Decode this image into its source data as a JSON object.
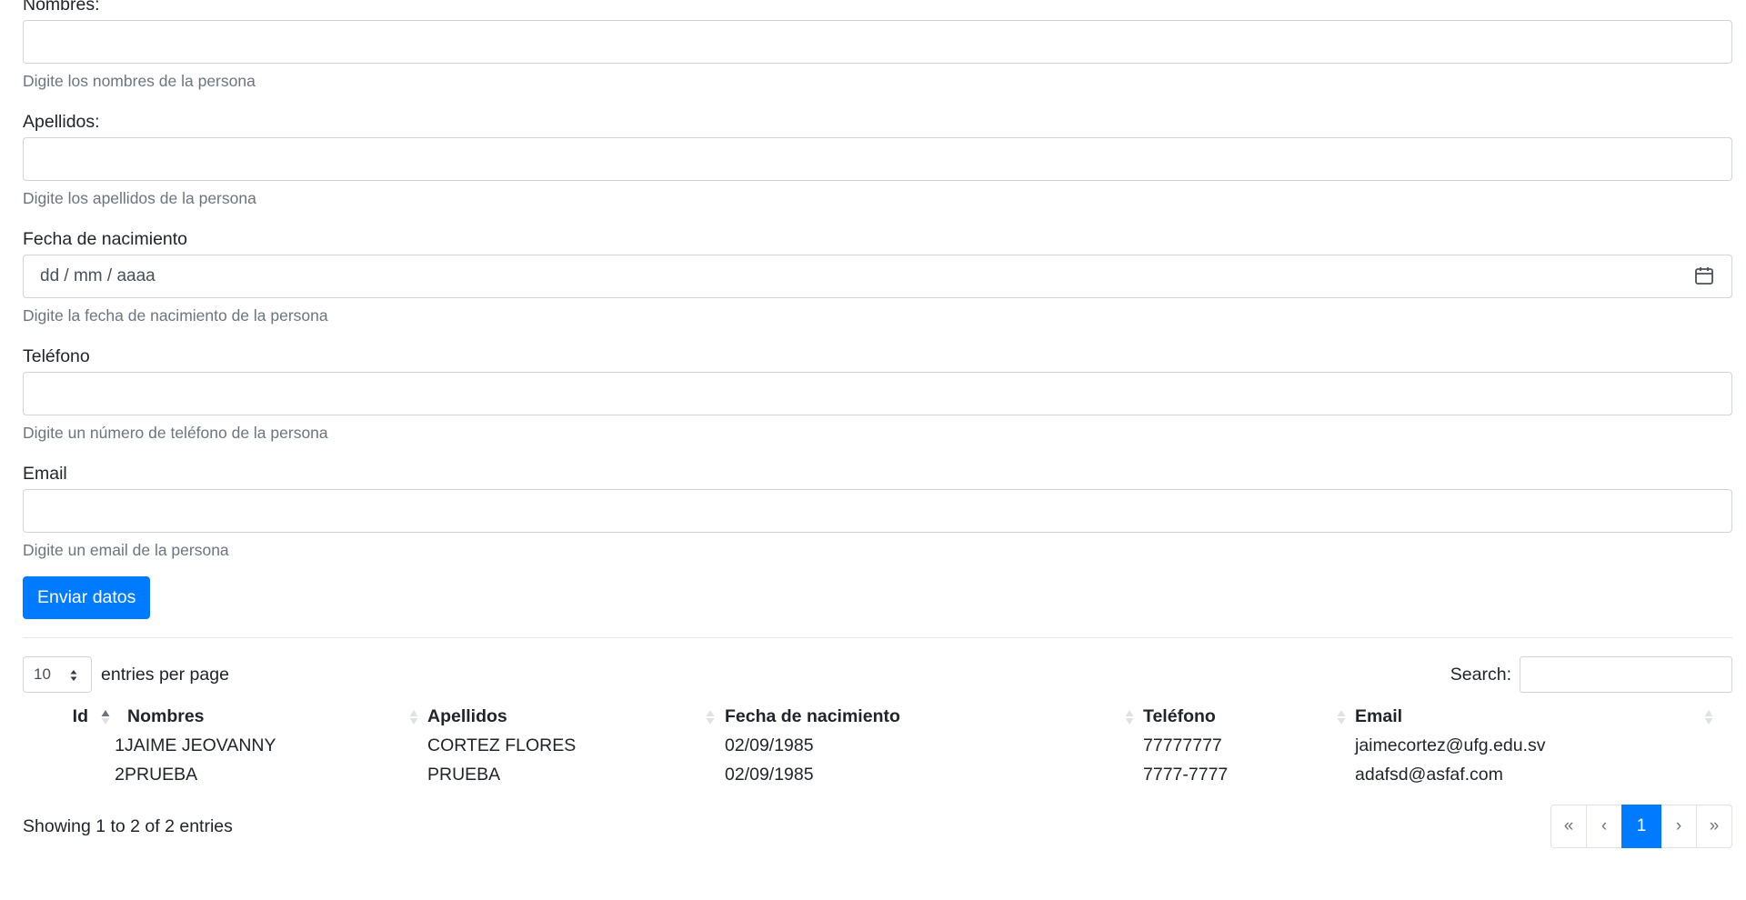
{
  "form": {
    "nombres": {
      "label": "Nombres:",
      "help": "Digite los nombres de la persona"
    },
    "apellidos": {
      "label": "Apellidos:",
      "help": "Digite los apellidos de la persona"
    },
    "fecha": {
      "label": "Fecha de nacimiento",
      "placeholder": "dd / mm / aaaa",
      "help": "Digite la fecha de nacimiento de la persona"
    },
    "telefono": {
      "label": "Teléfono",
      "help": "Digite un número de teléfono de la persona"
    },
    "email": {
      "label": "Email",
      "help": "Digite un email de la persona"
    },
    "submit_label": "Enviar datos"
  },
  "table": {
    "length_value": "10",
    "length_label": "entries per page",
    "search_label": "Search:",
    "columns": [
      "Id",
      "Nombres",
      "Apellidos",
      "Fecha de nacimiento",
      "Teléfono",
      "Email"
    ],
    "rows": [
      [
        "1",
        "JAIME JEOVANNY",
        "CORTEZ FLORES",
        "02/09/1985",
        "77777777",
        "jaimecortez@ufg.edu.sv"
      ],
      [
        "2",
        "PRUEBA",
        "PRUEBA",
        "02/09/1985",
        "7777-7777",
        "adafsd@asfaf.com"
      ]
    ],
    "info": "Showing 1 to 2 of 2 entries",
    "pager": [
      "«",
      "‹",
      "1",
      "›",
      "»"
    ]
  },
  "colors": {
    "primary": "#007bff",
    "muted": "#6c757d",
    "border": "#ced4da"
  },
  "icons": {
    "date": "calendar-icon",
    "sort": "sort-icon",
    "select": "select-caret-icon"
  }
}
